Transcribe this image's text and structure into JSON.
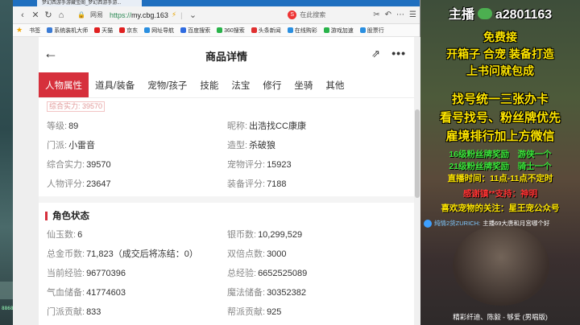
{
  "browser": {
    "tab_title": "梦幻西游手游藏宝阁_梦幻西游手游...",
    "url_site": "网易",
    "url_scheme": "https://",
    "url_host": "my.cbg.163",
    "search_placeholder": "在此搜索",
    "bookmarks": [
      "书签",
      "系统装机大师",
      "天猫",
      "京东",
      "网址导航",
      "百度搜索",
      "360搜索",
      "头条新闻",
      "在线购彩",
      "游戏加速",
      "股票行"
    ]
  },
  "page": {
    "title": "商品详情",
    "tabs": [
      "人物属性",
      "道具/装备",
      "宠物/孩子",
      "技能",
      "法宝",
      "修行",
      "坐骑",
      "其他"
    ],
    "faded_label": "综合实力: 39570",
    "basic": [
      {
        "k": "等级:",
        "v": "89"
      },
      {
        "k": "昵称:",
        "v": "出浩找CC康康"
      },
      {
        "k": "门派:",
        "v": "小雷音"
      },
      {
        "k": "造型:",
        "v": "杀破狼"
      },
      {
        "k": "综合实力:",
        "v": "39570"
      },
      {
        "k": "宠物评分:",
        "v": "15923"
      },
      {
        "k": "人物评分:",
        "v": "23647"
      },
      {
        "k": "装备评分:",
        "v": "7188"
      }
    ],
    "section_title": "角色状态",
    "status": [
      {
        "k": "仙玉数:",
        "v": "6"
      },
      {
        "k": "银币数:",
        "v": "10,299,529"
      },
      {
        "k": "总金币数:",
        "v": "71,823（成交后将冻结：0）"
      },
      {
        "k": "双倍点数:",
        "v": "3000"
      },
      {
        "k": "当前经验:",
        "v": "96770396"
      },
      {
        "k": "总经验:",
        "v": "6652525089"
      },
      {
        "k": "气血储备:",
        "v": "41774603"
      },
      {
        "k": "魔法储备:",
        "v": "30352382"
      },
      {
        "k": "门派贡献:",
        "v": "833"
      },
      {
        "k": "帮派贡献:",
        "v": "925"
      }
    ]
  },
  "overlay": {
    "host_label": "主播",
    "host_id": "a2801163",
    "lines_big": [
      "免费接",
      "开箱子 合宠 装备打造",
      "上书问就包成"
    ],
    "lines_big2": [
      "找号统一三张办卡",
      "看号找号、粉丝牌优先",
      "雇境排行加上方微信"
    ],
    "green_lines": [
      "16级粉丝牌奖励　游侠一个",
      "21级粉丝牌奖励　骑士一个"
    ],
    "yellow_line1": "直播时间：11点-11点不定时",
    "red_line": "感谢镇**支持：神明",
    "yellow_line2": "喜欢宠物的关注：星王宠公众号",
    "chat_name": "纯情2货ZURICH:",
    "chat_text": "主播69大唐和月宫哪个好",
    "footer": "精彩纤迪、陈毅 - 够爱 (男唱版)",
    "left_tag": "8868407"
  }
}
